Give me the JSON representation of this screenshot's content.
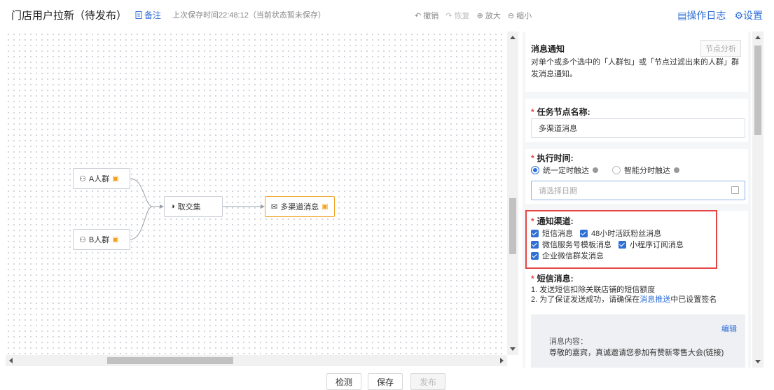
{
  "header": {
    "title": "门店用户拉新（待发布）",
    "note_label": "备注",
    "saved_text": "上次保存时间22:48:12（当前状态暂未保存）",
    "undo": "撤销",
    "redo": "恢复",
    "zoom_in": "放大",
    "zoom_out": "缩小",
    "log": "操作日志",
    "settings": "设置"
  },
  "canvas": {
    "nodes": {
      "a": "A人群",
      "b": "B人群",
      "intersect": "取交集",
      "message": "多渠道消息"
    }
  },
  "panel": {
    "heading": "消息通知",
    "analysis_button": "节点分析",
    "description": "对单个或多个选中的「人群包」或「节点过滤出来的人群」群发消息通知。",
    "task_name_label": "任务节点名称:",
    "task_name_value": "多渠道消息",
    "exec_time_label": "执行时间:",
    "radio_fixed": "统一定时触达",
    "radio_smart": "智能分时触达",
    "date_placeholder": "请选择日期",
    "channel_label": "通知渠道:",
    "channels": {
      "sms": "短信消息",
      "fans48": "48小时活跃粉丝消息",
      "wx_template": "微信服务号模板消息",
      "mini_program": "小程序订阅消息",
      "wecom": "企业微信群发消息"
    },
    "sms_label": "短信消息:",
    "sms_rule1": "1. 发送短信扣除关联店铺的短信额度",
    "sms_rule2_pre": "2. 为了保证发送成功，请确保在",
    "sms_rule2_link": "消息推送",
    "sms_rule2_post": "中已设置签名",
    "edit": "编辑",
    "msg_label": "消息内容：",
    "msg_text": "尊敬的嘉宾，真诚邀请您参加有赞新零售大会(链接)"
  },
  "footer": {
    "check": "检测",
    "save": "保存",
    "publish": "发布"
  },
  "colors": {
    "accent": "#2f6fd6",
    "highlight": "#e54545",
    "node_active": "#f0a020"
  }
}
